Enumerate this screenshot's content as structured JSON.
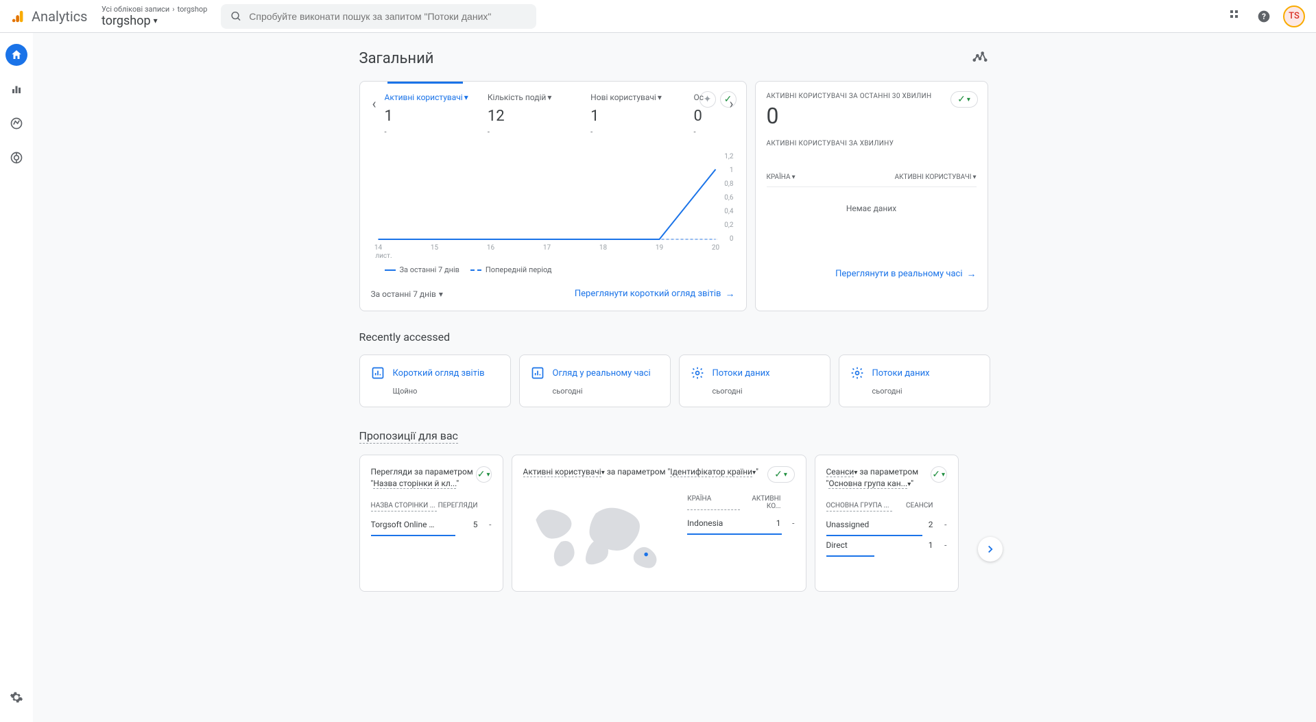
{
  "header": {
    "product": "Analytics",
    "breadcrumb_all": "Усі облікові записи",
    "breadcrumb_prop": "torgshop",
    "property": "torgshop",
    "search_placeholder": "Спробуйте виконати пошук за запитом \"Потоки даних\"",
    "avatar": "TS"
  },
  "page": {
    "title": "Загальний"
  },
  "metrics": [
    {
      "label": "Активні користувачі",
      "value": "1",
      "sub": "-",
      "active": true
    },
    {
      "label": "Кількість подій",
      "value": "12",
      "sub": "-",
      "active": false
    },
    {
      "label": "Нові користувачі",
      "value": "1",
      "sub": "-",
      "active": false
    },
    {
      "label": "Ос",
      "value": "0",
      "sub": "-",
      "active": false
    }
  ],
  "chart_data": {
    "type": "line",
    "x_labels": [
      "14",
      "15",
      "16",
      "17",
      "18",
      "19",
      "20"
    ],
    "x_sublabel": "лист.",
    "series": [
      {
        "name": "За останні 7 днів",
        "values": [
          0,
          0,
          0,
          0,
          0,
          0,
          1
        ],
        "style": "solid",
        "color": "#1a73e8"
      },
      {
        "name": "Попередній період",
        "values": [
          0,
          0,
          0,
          0,
          0,
          0,
          0
        ],
        "style": "dashed",
        "color": "#1a73e8"
      }
    ],
    "y_ticks": [
      "0",
      "0,2",
      "0,4",
      "0,6",
      "0,8",
      "1",
      "1,2"
    ],
    "ylim": [
      0,
      1.2
    ]
  },
  "legend": {
    "current": "За останні 7 днів",
    "previous": "Попередній період"
  },
  "card_main": {
    "date_range": "За останні 7 днів",
    "footer_link": "Переглянути короткий огляд звітів"
  },
  "realtime": {
    "label1": "АКТИВНІ КОРИСТУВАЧІ ЗА ОСТАННІ 30 ХВИЛИН",
    "big_value": "0",
    "label2": "АКТИВНІ КОРИСТУВАЧІ ЗА ХВИЛИНУ",
    "col1": "КРАЇНА",
    "col2": "АКТИВНІ КОРИСТУВАЧІ",
    "empty": "Немає даних",
    "footer_link": "Переглянути в реальному часі"
  },
  "recent": {
    "title": "Recently accessed",
    "items": [
      {
        "title": "Короткий огляд звітів",
        "sub": "Щойно",
        "icon": "bar"
      },
      {
        "title": "Огляд у реальному часі",
        "sub": "сьогодні",
        "icon": "bar"
      },
      {
        "title": "Потоки даних",
        "sub": "сьогодні",
        "icon": "gear"
      },
      {
        "title": "Потоки даних",
        "sub": "сьогодні",
        "icon": "gear"
      }
    ]
  },
  "suggestions": {
    "title": "Пропозиції для вас",
    "cards": [
      {
        "title_prefix": "Перегляди",
        "title_mid": " за параметром \"",
        "title_dotted": "Назва сторінки й кл...",
        "title_suffix": "\"",
        "col1": "НАЗВА СТОРІНКИ ...",
        "col2": "ПЕРЕГЛЯДИ",
        "rows": [
          {
            "c1": "Torgsoft Online Mark...",
            "c2": "5",
            "c3": "-"
          }
        ]
      },
      {
        "title_dotted1": "Активні користувачі",
        "title_mid": " за параметром \"",
        "title_dotted2": "Ідентифікатор країни",
        "title_suffix": "\"",
        "col1": "КРАЇНА",
        "col2": "АКТИВНІ КО...",
        "rows": [
          {
            "c1": "Indonesia",
            "c2": "1",
            "c3": "-"
          }
        ]
      },
      {
        "title_dotted1": "Сеанси",
        "title_mid": " за параметром \"",
        "title_dotted2": "Основна група кан...",
        "title_suffix": "\"",
        "col1": "ОСНОВНА ГРУПА ...",
        "col2": "СЕАНСИ",
        "rows": [
          {
            "c1": "Unassigned",
            "c2": "2",
            "c3": "-"
          },
          {
            "c1": "Direct",
            "c2": "1",
            "c3": "-"
          }
        ]
      }
    ]
  }
}
